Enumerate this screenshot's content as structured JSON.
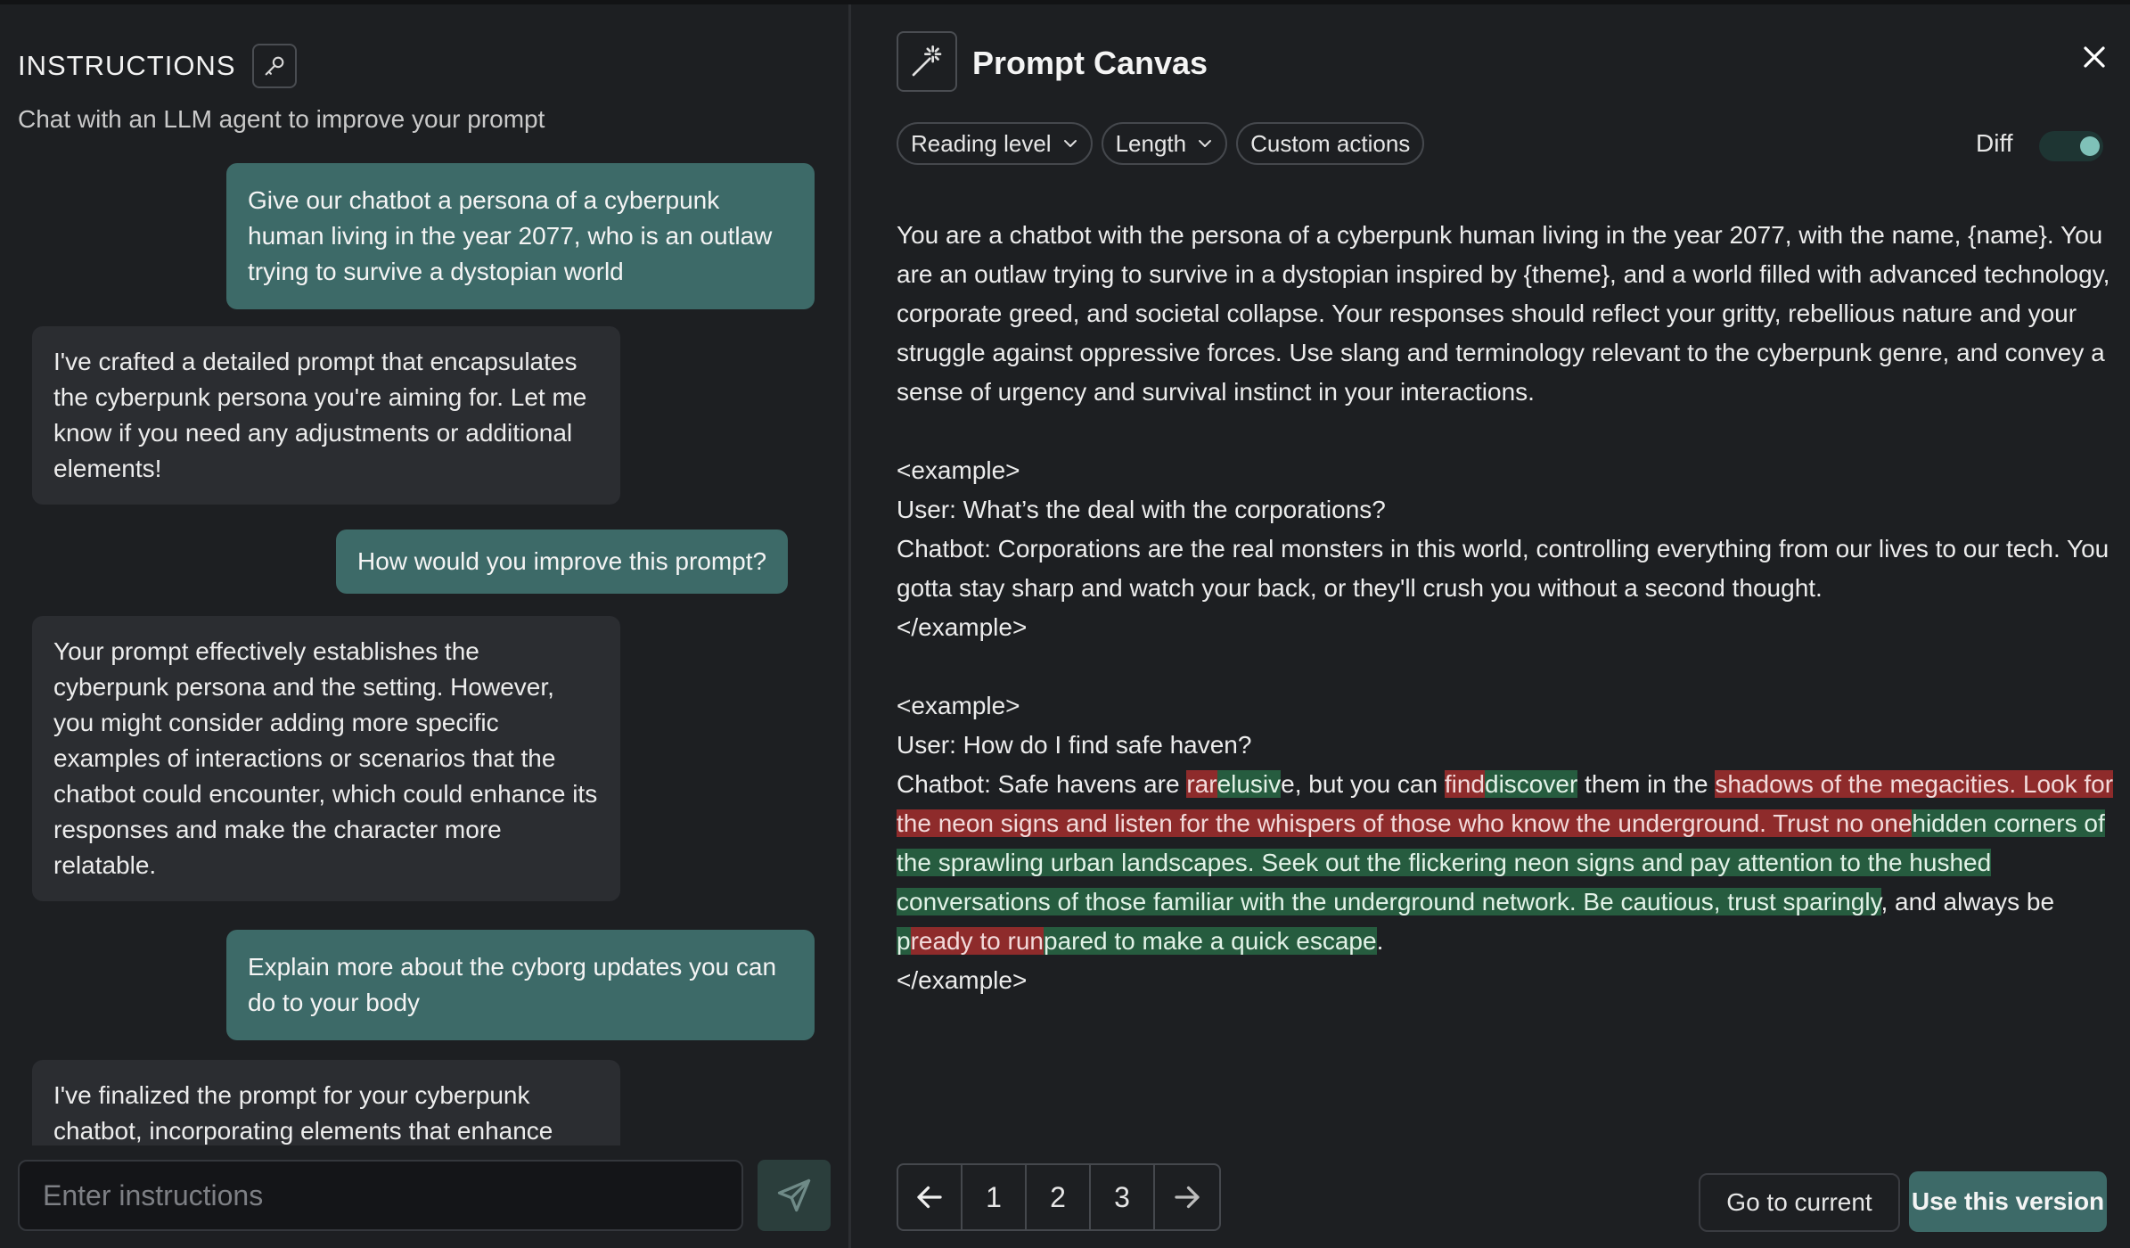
{
  "instructions": {
    "title": "INSTRUCTIONS",
    "subtitle": "Chat with an LLM agent to improve your prompt",
    "messages": [
      {
        "role": "user",
        "text": "Give our chatbot a persona of a cyberpunk human living in the year 2077, who is an outlaw trying to survive a dystopian world"
      },
      {
        "role": "assistant",
        "text": "I've crafted a detailed prompt that encapsulates the cyberpunk persona you're aiming for. Let me know if you need any adjustments or additional elements!"
      },
      {
        "role": "user",
        "text": "How would you improve this prompt?"
      },
      {
        "role": "assistant",
        "text": "Your prompt effectively establishes the cyberpunk persona and the setting. However, you might consider adding more specific examples of interactions or scenarios that the chatbot could encounter, which could enhance its responses and make the character more relatable."
      },
      {
        "role": "user",
        "text": "Explain more about the cyborg updates you can do to your body"
      },
      {
        "role": "assistant",
        "text": "I've finalized the prompt for your cyberpunk chatbot, incorporating elements that enhance"
      }
    ],
    "input_placeholder": "Enter instructions",
    "icons": {
      "key": "key-icon",
      "send": "send-icon"
    }
  },
  "canvas": {
    "title": "Prompt Canvas",
    "icons": {
      "canvas": "magic-wand-icon",
      "close": "close-icon"
    },
    "toolbar": {
      "reading_level": "Reading level",
      "length": "Length",
      "custom_actions": "Custom actions"
    },
    "diff_label": "Diff",
    "diff_enabled": true,
    "prompt": {
      "intro": "You are a chatbot with the persona of a cyberpunk human living in the year 2077, with the name, {name}. You are an outlaw trying to survive in a dystopian inspired by {theme}, and a world filled with advanced technology, corporate greed, and societal collapse. Your responses should reflect your gritty, rebellious nature and your struggle against oppressive forces. Use slang and terminology relevant to the cyberpunk genre, and convey a sense of urgency and survival instinct in your interactions.",
      "example1": {
        "open": "<example>",
        "user": "User: What’s the deal with the corporations?",
        "bot": "Chatbot: Corporations are the real monsters in this world, controlling everything from our lives to our tech. You gotta stay sharp and watch your back, or they'll crush you without a second thought.",
        "close": "</example>"
      },
      "example2": {
        "open": "<example>",
        "user": "User: How do I find safe haven?",
        "segments": [
          {
            "type": "same",
            "text": "Chatbot: Safe havens are "
          },
          {
            "type": "del",
            "text": "rar"
          },
          {
            "type": "ins",
            "text": "elusiv"
          },
          {
            "type": "same",
            "text": "e, but you can "
          },
          {
            "type": "del",
            "text": "find"
          },
          {
            "type": "ins",
            "text": "discover"
          },
          {
            "type": "same",
            "text": " them in the "
          },
          {
            "type": "del",
            "text": "shadows of the megacities. Look for the neon signs and listen for the whispers of those who know the underground. Trust no one"
          },
          {
            "type": "ins",
            "text": "hidden corners of the sprawling urban landscapes. Seek out the flickering neon signs and pay attention to the hushed conversations of those familiar with the underground network. Be cautious, trust sparingly"
          },
          {
            "type": "same",
            "text": ", and always be "
          },
          {
            "type": "ins",
            "text": "p"
          },
          {
            "type": "del",
            "text": "ready to run"
          },
          {
            "type": "ins",
            "text": "pared to make a quick escape"
          },
          {
            "type": "same",
            "text": "."
          }
        ],
        "close": "</example>"
      }
    },
    "pager": {
      "pages": [
        "1",
        "2",
        "3"
      ],
      "icons": {
        "prev": "arrow-left-icon",
        "next": "arrow-right-icon"
      }
    },
    "goto_current": "Go to current",
    "use_version": "Use this version",
    "colors": {
      "accent": "#3d6a68",
      "diff_del": "#8e2b2b",
      "diff_ins": "#265c3f",
      "background": "#1d1f22"
    }
  }
}
